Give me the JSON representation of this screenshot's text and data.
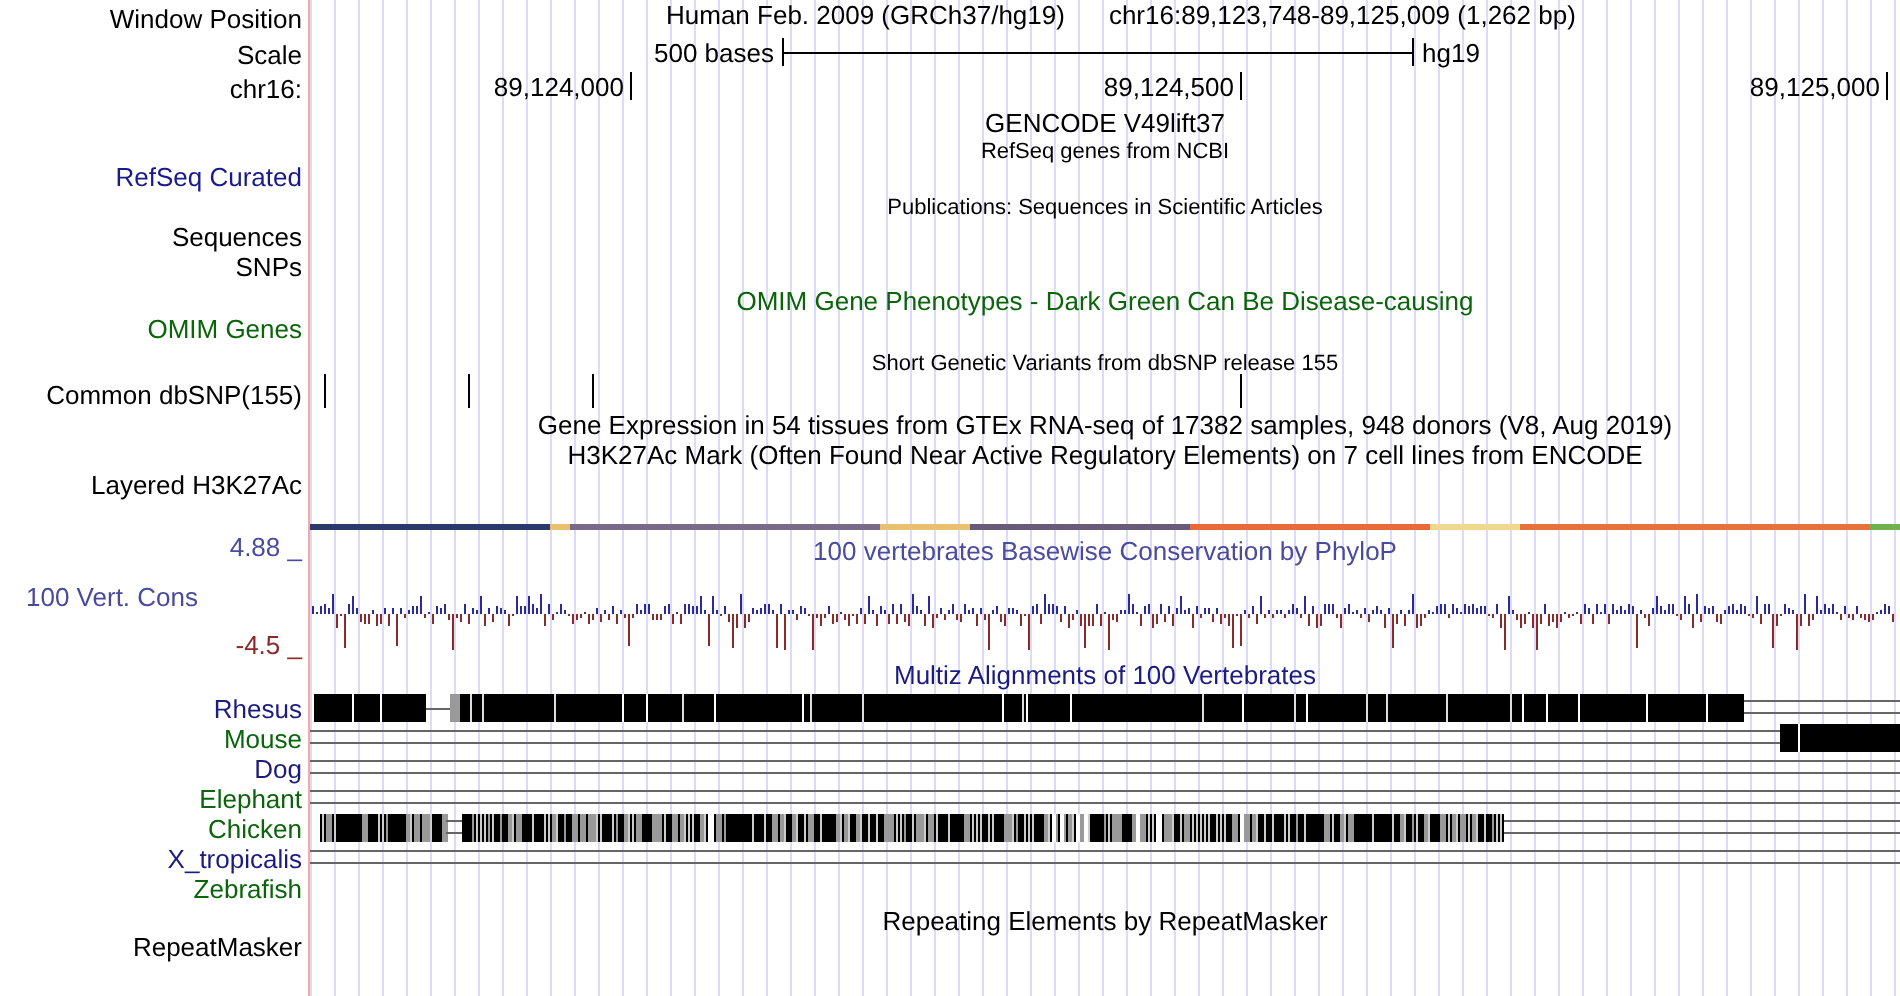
{
  "tracks": [
    {
      "kind": "position",
      "labels": [
        "Window Position"
      ],
      "assembly": "Human Feb. 2009 (GRCh37/hg19)",
      "range": "chr16:89,123,748-89,125,009 (1,262 bp)"
    },
    {
      "kind": "scale",
      "labels": [
        "Scale"
      ],
      "bar_label": "500 bases",
      "assembly": "hg19"
    },
    {
      "kind": "ruler",
      "labels": [
        "chr16:"
      ],
      "ticks": [
        "89,124,000",
        "89,124,500",
        "89,125,000"
      ]
    },
    {
      "kind": "title",
      "title": "GENCODE V49lift37"
    },
    {
      "kind": "compact",
      "title": "RefSeq genes from NCBI",
      "labels": [
        "RefSeq Curated"
      ],
      "color": "#1a1a8c"
    },
    {
      "kind": "compact",
      "title": "Publications: Sequences in Scientific Articles",
      "labels": [
        "Sequences",
        "SNPs"
      ],
      "color": "#000000"
    },
    {
      "kind": "full",
      "title": "OMIM Gene Phenotypes - Dark Green Can Be Disease-causing",
      "labels": [
        "OMIM Genes"
      ],
      "color": "#0a640a"
    },
    {
      "kind": "variants",
      "title": "Short Genetic Variants from dbSNP release 155",
      "labels": [
        "Common dbSNP(155)"
      ],
      "color": "#000000"
    },
    {
      "kind": "title",
      "title": "Gene Expression in 54 tissues from GTEx RNA-seq of 17382 samples, 948 donors (V8, Aug 2019)"
    },
    {
      "kind": "signal",
      "title": "H3K27Ac Mark (Often Found Near Active Regulatory Elements) on 7 cell lines from ENCODE",
      "labels": [
        "Layered H3K27Ac"
      ],
      "color": "#000000"
    },
    {
      "kind": "wiggle",
      "title": "100 vertebrates Basewise Conservation by PhyloP",
      "labels": [
        "100 Vert. Cons"
      ],
      "y_max": "4.88 _",
      "y_min": "-4.5 _",
      "color": "#4a4a9e"
    },
    {
      "kind": "multiz",
      "title": "Multiz Alignments of 100 Vertebrates",
      "color": "#1c1c80",
      "species": [
        {
          "name": "Rhesus",
          "color": "#1c1c80"
        },
        {
          "name": "Mouse",
          "color": "#0a640a"
        },
        {
          "name": "Dog",
          "color": "#1c1c80"
        },
        {
          "name": "Elephant",
          "color": "#0a640a"
        },
        {
          "name": "Chicken",
          "color": "#0a640a"
        },
        {
          "name": "X_tropicalis",
          "color": "#1c1c80"
        },
        {
          "name": "Zebrafish",
          "color": "#0a640a"
        }
      ]
    },
    {
      "kind": "full",
      "title": "Repeating Elements by RepeatMasker",
      "labels": [
        "RepeatMasker"
      ],
      "color": "#000000"
    }
  ]
}
